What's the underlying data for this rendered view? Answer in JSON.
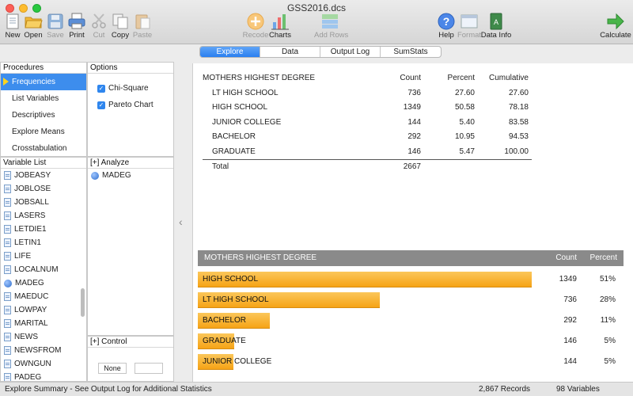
{
  "window": {
    "title": "GSS2016.dcs"
  },
  "toolbar": {
    "new": "New",
    "open": "Open",
    "save": "Save",
    "print": "Print",
    "cut": "Cut",
    "copy": "Copy",
    "paste": "Paste",
    "recode": "Recode",
    "charts": "Charts",
    "add_rows": "Add Rows",
    "help": "Help",
    "format": "Format",
    "data_info": "Data Info",
    "calculate": "Calculate"
  },
  "tabs": [
    "Explore",
    "Data",
    "Output Log",
    "SumStats"
  ],
  "procedures": {
    "header": "Procedures",
    "items": [
      "Frequencies",
      "List Variables",
      "Descriptives",
      "Explore Means",
      "Crosstabulation"
    ]
  },
  "options": {
    "header": "Options",
    "items": [
      "Chi-Square",
      "Pareto Chart"
    ]
  },
  "variable_list": {
    "header": "Variable List",
    "items": [
      "JOBEASY",
      "JOBLOSE",
      "JOBSALL",
      "LASERS",
      "LETDIE1",
      "LETIN1",
      "LIFE",
      "LOCALNUM",
      "MADEG",
      "MAEDUC",
      "LOWPAY",
      "MARITAL",
      "NEWS",
      "NEWSFROM",
      "OWNGUN",
      "PADEG"
    ]
  },
  "analyze": {
    "header": "[+] Analyze",
    "items": [
      "MADEG"
    ]
  },
  "control": {
    "header": "[+] Control",
    "none_button": "None"
  },
  "freq_table": {
    "title": "MOTHERS HIGHEST DEGREE",
    "headers": [
      "Count",
      "Percent",
      "Cumulative"
    ],
    "rows": [
      [
        "LT HIGH SCHOOL",
        "736",
        "27.60",
        "27.60"
      ],
      [
        "HIGH SCHOOL",
        "1349",
        "50.58",
        "78.18"
      ],
      [
        "JUNIOR COLLEGE",
        "144",
        "5.40",
        "83.58"
      ],
      [
        "BACHELOR",
        "292",
        "10.95",
        "94.53"
      ],
      [
        "GRADUATE",
        "146",
        "5.47",
        "100.00"
      ]
    ],
    "total_label": "Total",
    "total_value": "2667"
  },
  "pareto": {
    "title": "MOTHERS HIGHEST DEGREE",
    "count_header": "Count",
    "percent_header": "Percent",
    "max_count": 1349,
    "bars": [
      {
        "label": "HIGH SCHOOL",
        "count": 1349,
        "count_text": "1349",
        "pct": "51%"
      },
      {
        "label": "LT HIGH SCHOOL",
        "count": 736,
        "count_text": "736",
        "pct": "28%"
      },
      {
        "label": "BACHELOR",
        "count": 292,
        "count_text": "292",
        "pct": "11%"
      },
      {
        "label": "GRADUATE",
        "count": 146,
        "count_text": "146",
        "pct": "5%"
      },
      {
        "label": "JUNIOR COLLEGE",
        "count": 144,
        "count_text": "144",
        "pct": "5%"
      }
    ]
  },
  "status": {
    "summary": "Explore Summary  -  See Output Log for Additional Statistics",
    "records": "2,867 Records",
    "variables": "98 Variables"
  },
  "colors": {
    "accent": "#2f86ee",
    "bar": "#f6a316",
    "bar_header": "#8a8a8a"
  }
}
